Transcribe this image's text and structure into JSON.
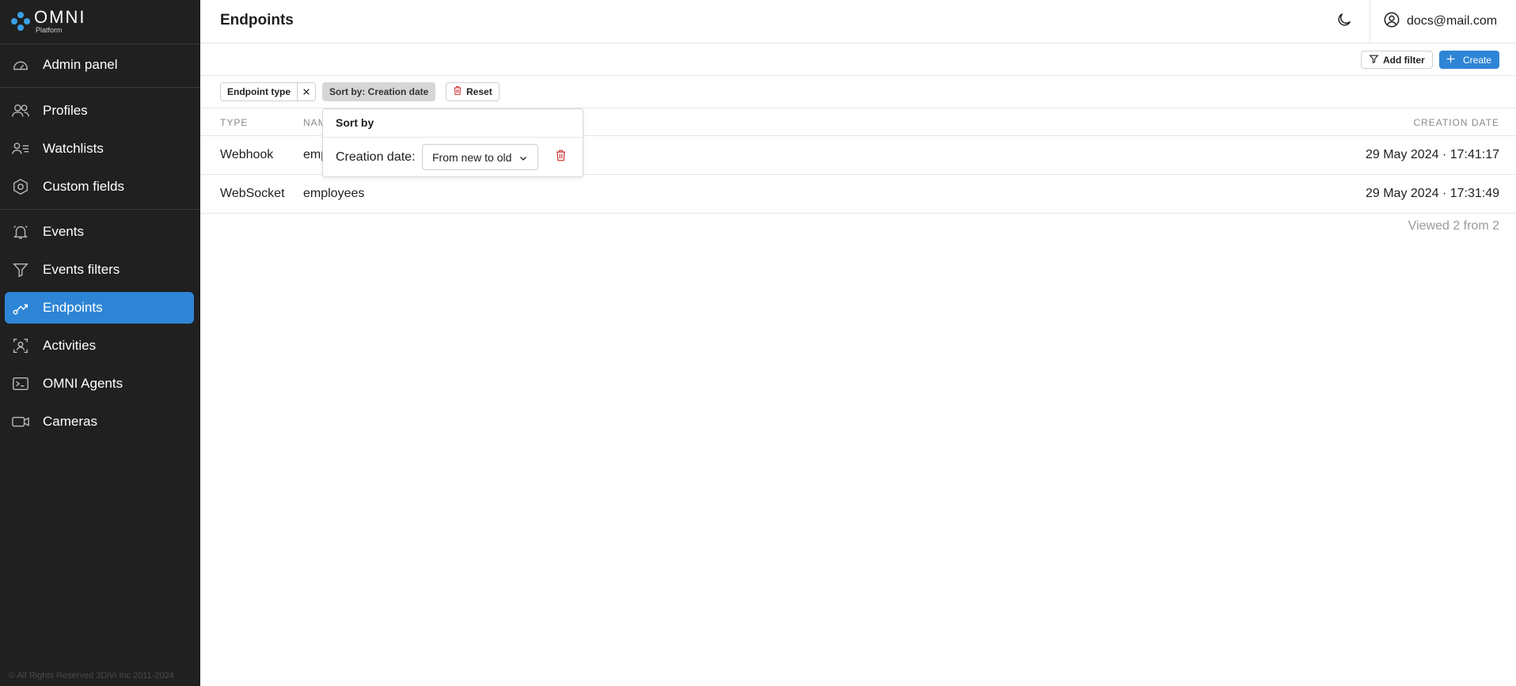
{
  "brand": {
    "name": "OMNI",
    "subtitle": "Platform",
    "accent": "#3aa0e8"
  },
  "sidebar": {
    "items": [
      {
        "label": "Admin panel",
        "icon": "gauge-icon"
      },
      {
        "label": "Profiles",
        "icon": "users-icon"
      },
      {
        "label": "Watchlists",
        "icon": "user-list-icon"
      },
      {
        "label": "Custom fields",
        "icon": "hexagon-icon"
      },
      {
        "label": "Events",
        "icon": "bell-icon"
      },
      {
        "label": "Events filters",
        "icon": "filter-icon"
      },
      {
        "label": "Endpoints",
        "icon": "route-icon",
        "active": true
      },
      {
        "label": "Activities",
        "icon": "face-scan-icon"
      },
      {
        "label": "OMNI Agents",
        "icon": "terminal-icon"
      },
      {
        "label": "Cameras",
        "icon": "video-icon"
      }
    ],
    "copyright": "© All Rights Reserved 3DiVi Inc 2011-2024",
    "active_color": "#2e85d6"
  },
  "header": {
    "title": "Endpoints",
    "user_email": "docs@mail.com"
  },
  "actions": {
    "add_filter": "Add filter",
    "create": "Create"
  },
  "filters": {
    "endpoint_type": "Endpoint type",
    "sort_chip": "Sort by: Creation date",
    "reset": "Reset"
  },
  "table": {
    "columns": {
      "type": "TYPE",
      "name": "NAME",
      "creation_date": "CREATION DATE"
    },
    "rows": [
      {
        "type": "Webhook",
        "name": "employees",
        "creation_date": "29 May 2024 · 17:41:17"
      },
      {
        "type": "WebSocket",
        "name": "employees",
        "creation_date": "29 May 2024 · 17:31:49"
      }
    ],
    "viewed": "Viewed 2 from 2"
  },
  "sort_popover": {
    "title": "Sort by",
    "field_label": "Creation date:",
    "selected_order": "From new to old"
  }
}
